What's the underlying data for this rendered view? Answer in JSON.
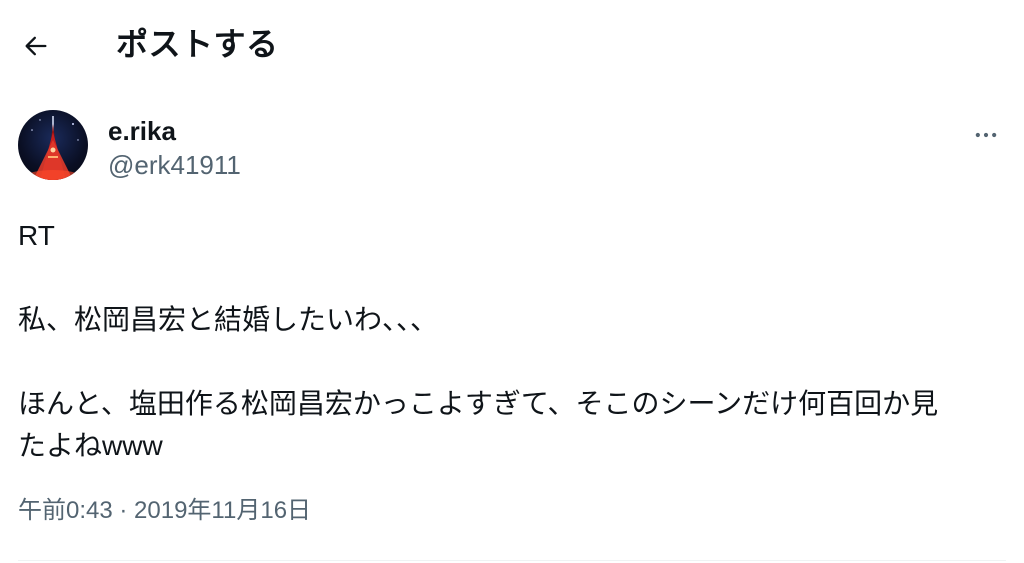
{
  "header": {
    "back_icon": "arrow-left-icon",
    "title": "ポストする"
  },
  "post": {
    "author": {
      "name": "e.rika",
      "handle": "@erk41911",
      "avatar_icon": "avatar-tower-night"
    },
    "more_icon": "more-horizontal-icon",
    "lines": [
      "RT",
      "",
      "私、松岡昌宏と結婚したいわ、、、",
      "",
      "ほんと、塩田作る松岡昌宏かっこよすぎて、そこのシーンだけ何百回か見",
      "たよねwww"
    ],
    "timestamp": "午前0:43 · 2019年11月16日"
  },
  "colors": {
    "text_primary": "#0f1419",
    "text_secondary": "#536471",
    "divider": "#eff3f4",
    "background": "#ffffff"
  }
}
